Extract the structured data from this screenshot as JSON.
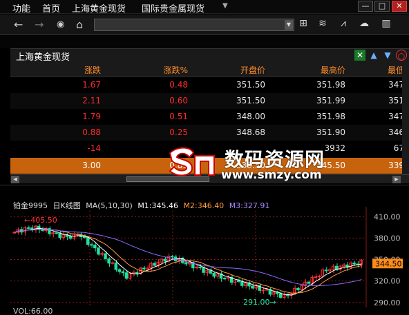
{
  "menu": {
    "items": [
      "功能",
      "首页",
      "上海黄金现货",
      "国际贵金属现货"
    ],
    "dropdown_icon": "triangle-down-icon",
    "window_buttons": [
      "—",
      "□",
      "✕"
    ]
  },
  "toolbar": {
    "left_icons": [
      "back-arrow-icon",
      "forward-arrow-icon",
      "refresh-icon",
      "home-icon"
    ],
    "right_icons": [
      "dropdown-icon",
      "network-icon",
      "rss-icon",
      "chart-icon",
      "cloud-icon",
      "bar-chart-icon"
    ]
  },
  "quote": {
    "title": "上海黄金现货",
    "headers": [
      "涨跌",
      "涨跌%",
      "开盘价",
      "最高价",
      "最低"
    ],
    "rows": [
      {
        "change": "1.67",
        "change_pct": "0.48",
        "open": "351.50",
        "high": "351.98",
        "low": "347"
      },
      {
        "change": "2.11",
        "change_pct": "0.60",
        "open": "351.50",
        "high": "351.99",
        "low": "351"
      },
      {
        "change": "1.79",
        "change_pct": "0.51",
        "open": "348.00",
        "high": "351.98",
        "low": "347"
      },
      {
        "change": "0.88",
        "change_pct": "0.25",
        "open": "348.68",
        "high": "351.90",
        "low": "346"
      },
      {
        "change": "-14",
        "change_pct": "",
        "open": "",
        "high": "3932",
        "low": "67"
      },
      {
        "change": "3.00",
        "change_pct": "0.89",
        "open": "339.50",
        "high": "345.50",
        "low": "339"
      }
    ]
  },
  "chart_header": {
    "symbol": "铂金9995",
    "period": "日K线图",
    "ma_label": "MA(5,10,30)",
    "m1": "M1:345.46",
    "m2": "M2:346.40",
    "m3": "M3:327.91"
  },
  "chart_data": {
    "type": "candlestick",
    "y_ticks": [
      "410.00",
      "380.00",
      "350.00",
      "320.00",
      "290.00"
    ],
    "ylim": [
      285,
      418
    ],
    "last_price": "344.50",
    "high_marker": "405.50",
    "low_marker": "291.00",
    "volume_label": "VOL:66.00",
    "ma_series": [
      {
        "name": "M1",
        "color": "#ffffff"
      },
      {
        "name": "M2",
        "color": "#ff9a3c"
      },
      {
        "name": "M3",
        "color": "#8a6bff"
      }
    ]
  },
  "watermark": {
    "text": "数码资源网",
    "url": "www.smzy.com"
  }
}
